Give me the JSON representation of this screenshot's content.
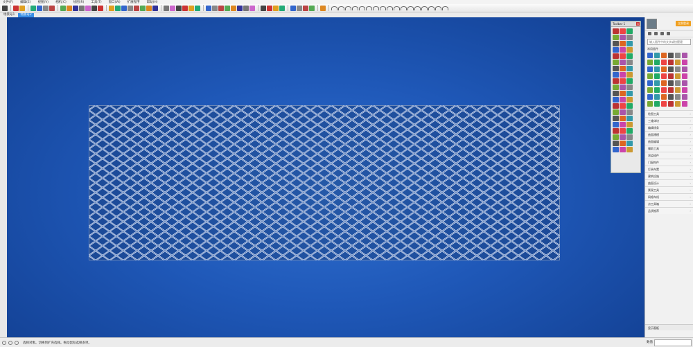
{
  "menubar": [
    "文件(F)",
    "编辑(E)",
    "视图(V)",
    "相机(C)",
    "绘图(R)",
    "工具(T)",
    "窗口(W)",
    "扩展程序",
    "帮助(H)"
  ],
  "tabs": [
    "场景号1",
    "场景号2"
  ],
  "active_tab": 1,
  "floating_toolbar": {
    "title": "Toolbar 1",
    "close": "×"
  },
  "right_panel": {
    "login_label": "立即登录",
    "search_placeholder": "输入插件中的文字或快捷键",
    "subtitle": "常用插件",
    "categories": [
      "绘图工具",
      "三维体块",
      "编辑线条",
      "曲面建模",
      "曲面编辑",
      "辅助工具",
      "渲染插件",
      "门窗构件",
      "灯具布置",
      "建筑设施",
      "曲面设计",
      "景观工具",
      "网格布线",
      "点工具箱",
      "品质推荐"
    ],
    "bottom_label": "显示面板"
  },
  "status": {
    "message": "选择对象。切换到扩充选择。拖动鼠标选择多项。",
    "measure_label": "数值"
  },
  "colors": {
    "viewport_center": "#2f6fd0",
    "viewport_edge": "#123f91",
    "mesh_line": "#c9d6f2",
    "accent": "#3a8ee6",
    "login": "#f0a020"
  }
}
